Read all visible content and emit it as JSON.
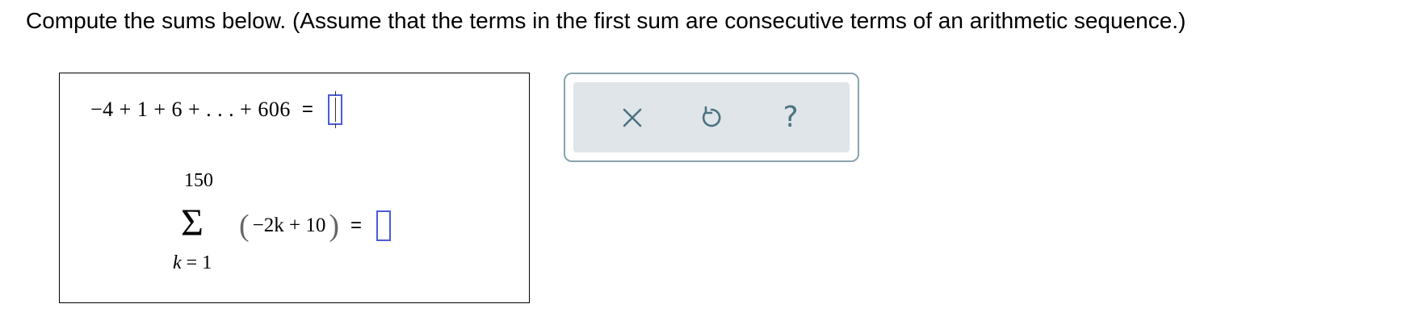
{
  "question": {
    "text": "Compute the sums below. (Assume that the terms in the first sum are consecutive terms of an arithmetic sequence.)"
  },
  "problem1": {
    "expression": "−4 + 1 + 6 + . . . + 606",
    "equals": "=",
    "answer_value": ""
  },
  "problem2": {
    "upper_limit": "150",
    "sigma": "Σ",
    "open_paren": "(",
    "summand": "−2k + 10",
    "close_paren": ")",
    "equals": "=",
    "lower_var": "k",
    "lower_eq": "=",
    "lower_value": "1",
    "answer_value": ""
  },
  "toolbar": {
    "clear_icon": "close-icon",
    "undo_icon": "undo-icon",
    "help_icon": "help-icon",
    "help_glyph": "?"
  },
  "colors": {
    "input_border": "#4a5bd6",
    "toolbar_border": "#8aa3ad",
    "toolbar_bg": "#dfe5e8",
    "icon_color": "#4d7282"
  }
}
